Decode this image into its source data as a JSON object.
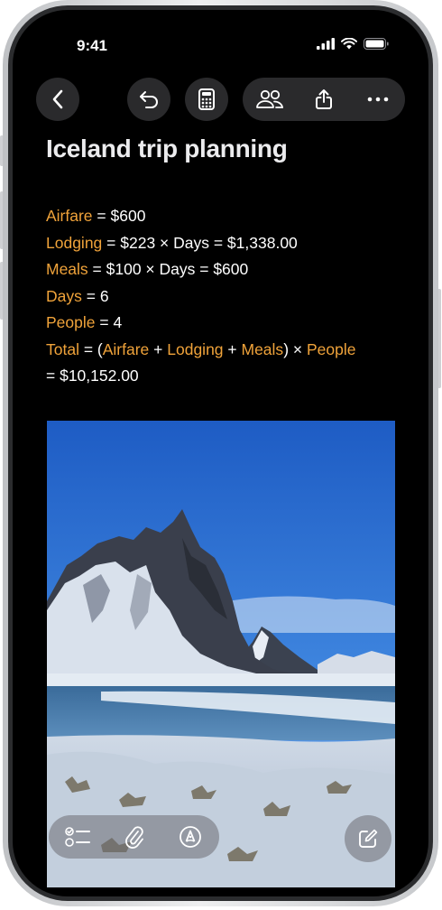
{
  "status_bar": {
    "time": "9:41"
  },
  "toolbar": {
    "back_icon": "chevron-left-icon",
    "undo_icon": "undo-icon",
    "calculator_icon": "calculator-icon",
    "collaborate_icon": "people-icon",
    "share_icon": "share-icon",
    "more_icon": "ellipsis-icon"
  },
  "note": {
    "title": "Iceland trip planning",
    "lines": {
      "airfare": {
        "var": "Airfare",
        "eq": " = $600"
      },
      "lodging": {
        "var": "Lodging",
        "eq": " = $223 × Days = $1,338.00"
      },
      "meals": {
        "var": "Meals",
        "eq": " = $100 × Days = $600"
      },
      "days": {
        "var": "Days",
        "eq": " = 6"
      },
      "people": {
        "var": "People",
        "eq": " = 4"
      },
      "total": {
        "var": "Total",
        "t1": " = (",
        "v1": "Airfare",
        "t2": " + ",
        "v2": "Lodging",
        "t3": " + ",
        "v3": "Meals",
        "t4": ") × ",
        "v4": "People",
        "result": "= $10,152.00"
      }
    }
  },
  "bottom_toolbar": {
    "checklist_icon": "checklist-icon",
    "attachment_icon": "paperclip-icon",
    "markup_icon": "pen-tip-icon",
    "compose_icon": "compose-icon"
  },
  "colors": {
    "accent": "#f0a33a",
    "background": "#000000",
    "text": "#ffffff"
  }
}
